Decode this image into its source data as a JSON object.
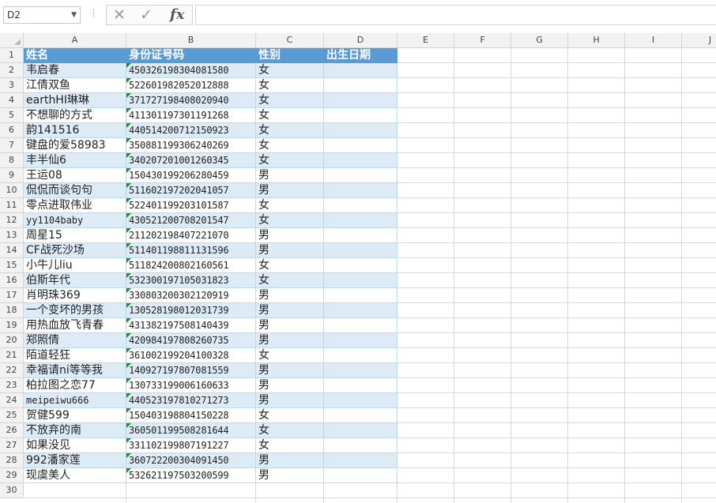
{
  "name_box": {
    "value": "D2"
  },
  "formula_bar": {
    "cancel_glyph": "✕",
    "enter_glyph": "✓",
    "fx_label": "fx",
    "content": ""
  },
  "columns": [
    "A",
    "B",
    "C",
    "D",
    "E",
    "F",
    "G",
    "H",
    "I",
    "J"
  ],
  "row_numbers": [
    "1",
    "2",
    "3",
    "4",
    "5",
    "6",
    "7",
    "8",
    "9",
    "10",
    "11",
    "12",
    "13",
    "14",
    "15",
    "16",
    "17",
    "18",
    "19",
    "20",
    "21",
    "22",
    "23",
    "24",
    "25",
    "26",
    "27",
    "28",
    "29",
    "30"
  ],
  "table": {
    "headers": [
      "姓名",
      "身份证号码",
      "性别",
      "出生日期"
    ],
    "rows": [
      [
        "韦启春",
        "450326198304081580",
        "女",
        ""
      ],
      [
        "江倩双鱼",
        "522601982052012888",
        "女",
        ""
      ],
      [
        "earthHI琳琳",
        "371727198408020940",
        "女",
        ""
      ],
      [
        "不想聊的方式",
        "411301197301191268",
        "女",
        ""
      ],
      [
        "韵141516",
        "440514200712150923",
        "女",
        ""
      ],
      [
        "键盘的爱58983",
        "350881199306240269",
        "女",
        ""
      ],
      [
        "丰半仙6",
        "340207201001260345",
        "女",
        ""
      ],
      [
        "王运08",
        "150430199206280459",
        "男",
        ""
      ],
      [
        "侃侃而谈句句",
        "511602197202041057",
        "男",
        ""
      ],
      [
        "零点进取伟业",
        "522401199203101587",
        "女",
        ""
      ],
      [
        "yy1104baby",
        "430521200708201547",
        "女",
        ""
      ],
      [
        "周星15",
        "211202198407221070",
        "男",
        ""
      ],
      [
        "CF战死沙场",
        "511401198811131596",
        "男",
        ""
      ],
      [
        "小牛儿liu",
        "511824200802160561",
        "女",
        ""
      ],
      [
        "伯斯年代",
        "532300197105031823",
        "女",
        ""
      ],
      [
        "肖明珠369",
        "330803200302120919",
        "男",
        ""
      ],
      [
        "一个变坏的男孩",
        "130528198012031739",
        "男",
        ""
      ],
      [
        "用热血放飞青春",
        "431382197508140439",
        "男",
        ""
      ],
      [
        "郑照倩",
        "420984197808260735",
        "男",
        ""
      ],
      [
        "陌道轻狂",
        "361002199204100328",
        "女",
        ""
      ],
      [
        "幸福请ni等等我",
        "140927197807081559",
        "男",
        ""
      ],
      [
        "柏拉图之恋77",
        "130733199006160633",
        "男",
        ""
      ],
      [
        "meipeiwu666",
        "440523197810271273",
        "男",
        ""
      ],
      [
        "贺健599",
        "150403198804150228",
        "女",
        ""
      ],
      [
        "不放弃的南",
        "360501199508281644",
        "女",
        ""
      ],
      [
        "如果没见",
        "331102199807191227",
        "女",
        ""
      ],
      [
        "992潘家莲",
        "360722200304091450",
        "男",
        ""
      ],
      [
        "现虞美人",
        "532621197503200599",
        "男",
        ""
      ]
    ]
  },
  "colors": {
    "header_fill": "#5b9bd5",
    "band_fill": "#ddebf7",
    "error_triangle": "#1e8a3c"
  }
}
